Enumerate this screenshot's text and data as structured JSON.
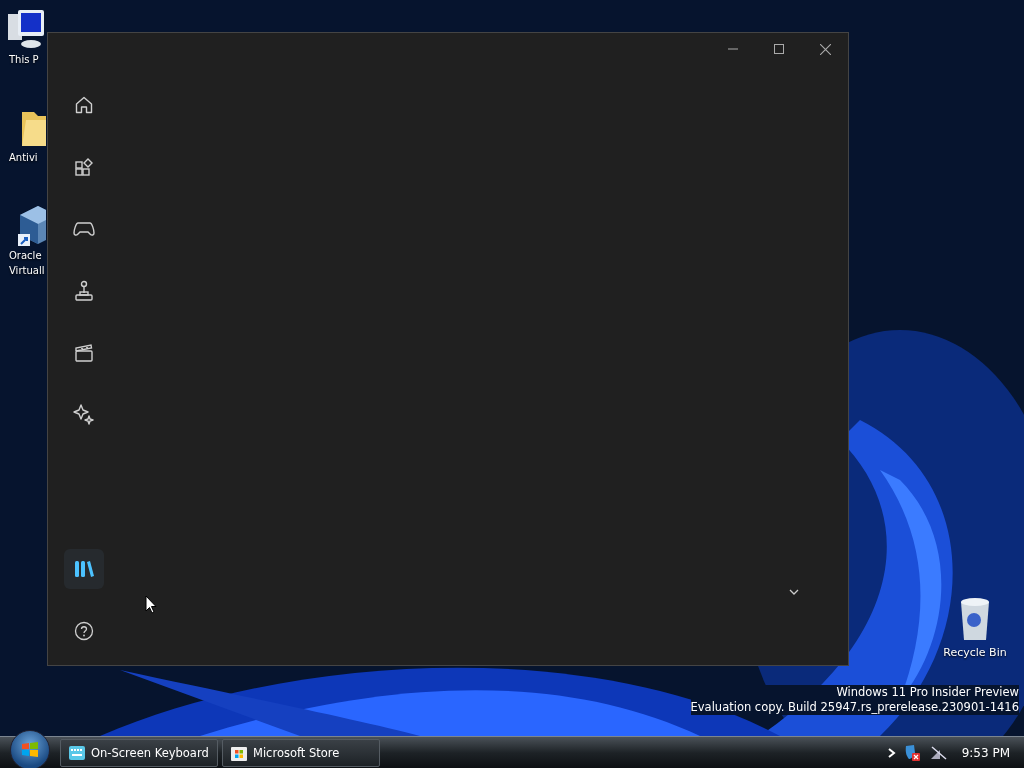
{
  "desktop_icons": [
    {
      "kind": "computer",
      "label": "This P"
    },
    {
      "kind": "folder",
      "label": "Antivi"
    },
    {
      "kind": "cube",
      "label": "Oracle\nVirtuall"
    }
  ],
  "recycle_bin": {
    "label": "Recycle Bin"
  },
  "watermark": [
    "Windows 11 Pro Insider Preview",
    "Evaluation copy. Build 25947.rs_prerelease.230901-1416"
  ],
  "window": {
    "nav": [
      {
        "kind": "home",
        "selected": false
      },
      {
        "kind": "apps",
        "selected": false
      },
      {
        "kind": "gaming",
        "selected": false
      },
      {
        "kind": "arcade",
        "selected": false
      },
      {
        "kind": "movies",
        "selected": false
      },
      {
        "kind": "ai",
        "selected": false
      },
      {
        "kind": "library",
        "selected": true
      }
    ],
    "help": {
      "kind": "help"
    }
  },
  "taskbar": {
    "tasks": [
      {
        "kind": "keyboard",
        "label": "On-Screen Keyboard"
      },
      {
        "kind": "store",
        "label": "Microsoft Store"
      }
    ],
    "clock": "9:53 PM"
  }
}
